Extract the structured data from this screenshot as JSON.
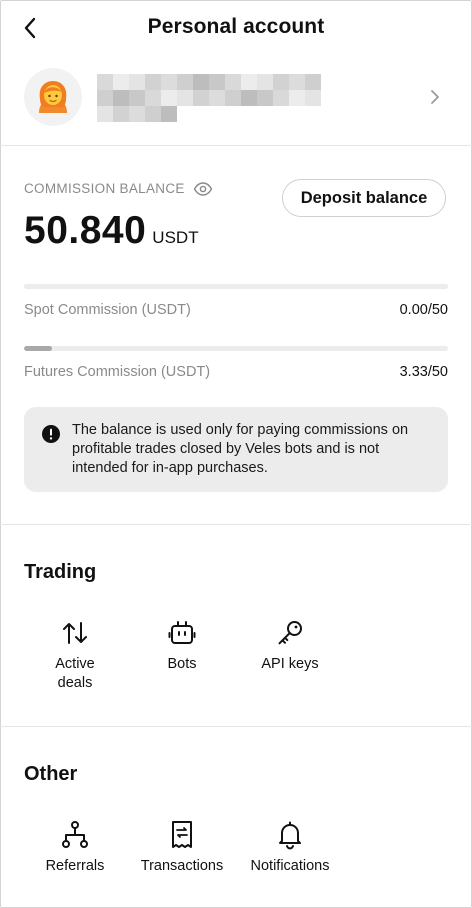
{
  "header": {
    "title": "Personal account",
    "back_icon": "chevron-left-icon"
  },
  "profile": {
    "avatar_icon": "person-avatar-icon",
    "chevron_icon": "chevron-right-icon"
  },
  "balance": {
    "label": "COMMISSION BALANCE",
    "eye_icon": "eye-icon",
    "amount": "50.840",
    "unit": "USDT",
    "deposit_label": "Deposit balance"
  },
  "commissions": [
    {
      "label": "Spot Commission (USDT)",
      "value": "0.00/50",
      "progress": 0.0
    },
    {
      "label": "Futures Commission (USDT)",
      "value": "3.33/50",
      "progress": 0.0666
    }
  ],
  "notice": {
    "icon": "exclamation-circle-icon",
    "text": "The balance is used only for paying commissions on profitable trades closed by Veles bots and is not intended for in-app purchases."
  },
  "trading": {
    "title": "Trading",
    "items": [
      {
        "label": "Active deals",
        "icon": "up-down-arrows-icon"
      },
      {
        "label": "Bots",
        "icon": "robot-icon"
      },
      {
        "label": "API keys",
        "icon": "key-icon"
      }
    ]
  },
  "other": {
    "title": "Other",
    "items": [
      {
        "label": "Referrals",
        "icon": "hierarchy-icon"
      },
      {
        "label": "Transactions",
        "icon": "receipt-icon"
      },
      {
        "label": "Notifications",
        "icon": "bell-icon"
      }
    ]
  },
  "colors": {
    "accent": "#111111",
    "muted": "#8a8a8a",
    "bar_track": "#ececec",
    "bar_fill": "#a9a9a9",
    "notice_bg": "#ececec"
  }
}
